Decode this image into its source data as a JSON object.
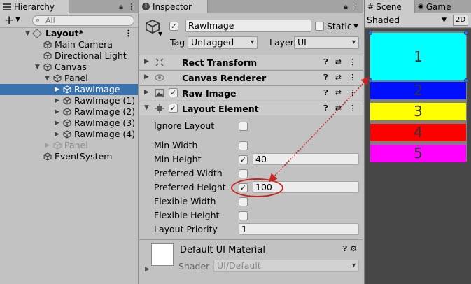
{
  "hierarchy": {
    "tab_label": "Hierarchy",
    "add_label": "+",
    "search_placeholder": "All",
    "items": [
      {
        "label": "Layout*"
      },
      {
        "label": "Main Camera"
      },
      {
        "label": "Directional Light"
      },
      {
        "label": "Canvas"
      },
      {
        "label": "Panel"
      },
      {
        "label": "RawImage"
      },
      {
        "label": "RawImage (1)"
      },
      {
        "label": "RawImage (2)"
      },
      {
        "label": "RawImage (3)"
      },
      {
        "label": "RawImage (4)"
      },
      {
        "label": "Panel"
      },
      {
        "label": "EventSystem"
      }
    ]
  },
  "inspector": {
    "tab_label": "Inspector",
    "object_name": "RawImage",
    "static_label": "Static",
    "tag_label": "Tag",
    "tag_value": "Untagged",
    "layer_label": "Layer",
    "layer_value": "UI",
    "components": [
      {
        "label": "Rect Transform"
      },
      {
        "label": "Canvas Renderer"
      },
      {
        "label": "Raw Image"
      },
      {
        "label": "Layout Element"
      }
    ],
    "layout_props": {
      "ignore_layout": "Ignore Layout",
      "min_width": "Min Width",
      "min_height": "Min Height",
      "min_height_value": "40",
      "preferred_width": "Preferred Width",
      "preferred_height": "Preferred Height",
      "preferred_height_value": "100",
      "flexible_width": "Flexible Width",
      "flexible_height": "Flexible Height",
      "layout_priority": "Layout Priority",
      "layout_priority_value": "1"
    },
    "material_name": "Default UI Material",
    "shader_label": "Shader",
    "shader_value": "UI/Default"
  },
  "scene": {
    "tab_scene": "Scene",
    "tab_game": "Game",
    "shading": "Shaded",
    "mode_2d": "2D",
    "blocks": [
      {
        "label": "1",
        "color": "#00ffff"
      },
      {
        "label": "2",
        "color": "#0010ff"
      },
      {
        "label": "3",
        "color": "#ffff00"
      },
      {
        "label": "4",
        "color": "#ff0000"
      },
      {
        "label": "5",
        "color": "#ff00ff"
      }
    ]
  },
  "colors": {
    "selection": "#3a72b0",
    "annotation": "#cc2222"
  }
}
